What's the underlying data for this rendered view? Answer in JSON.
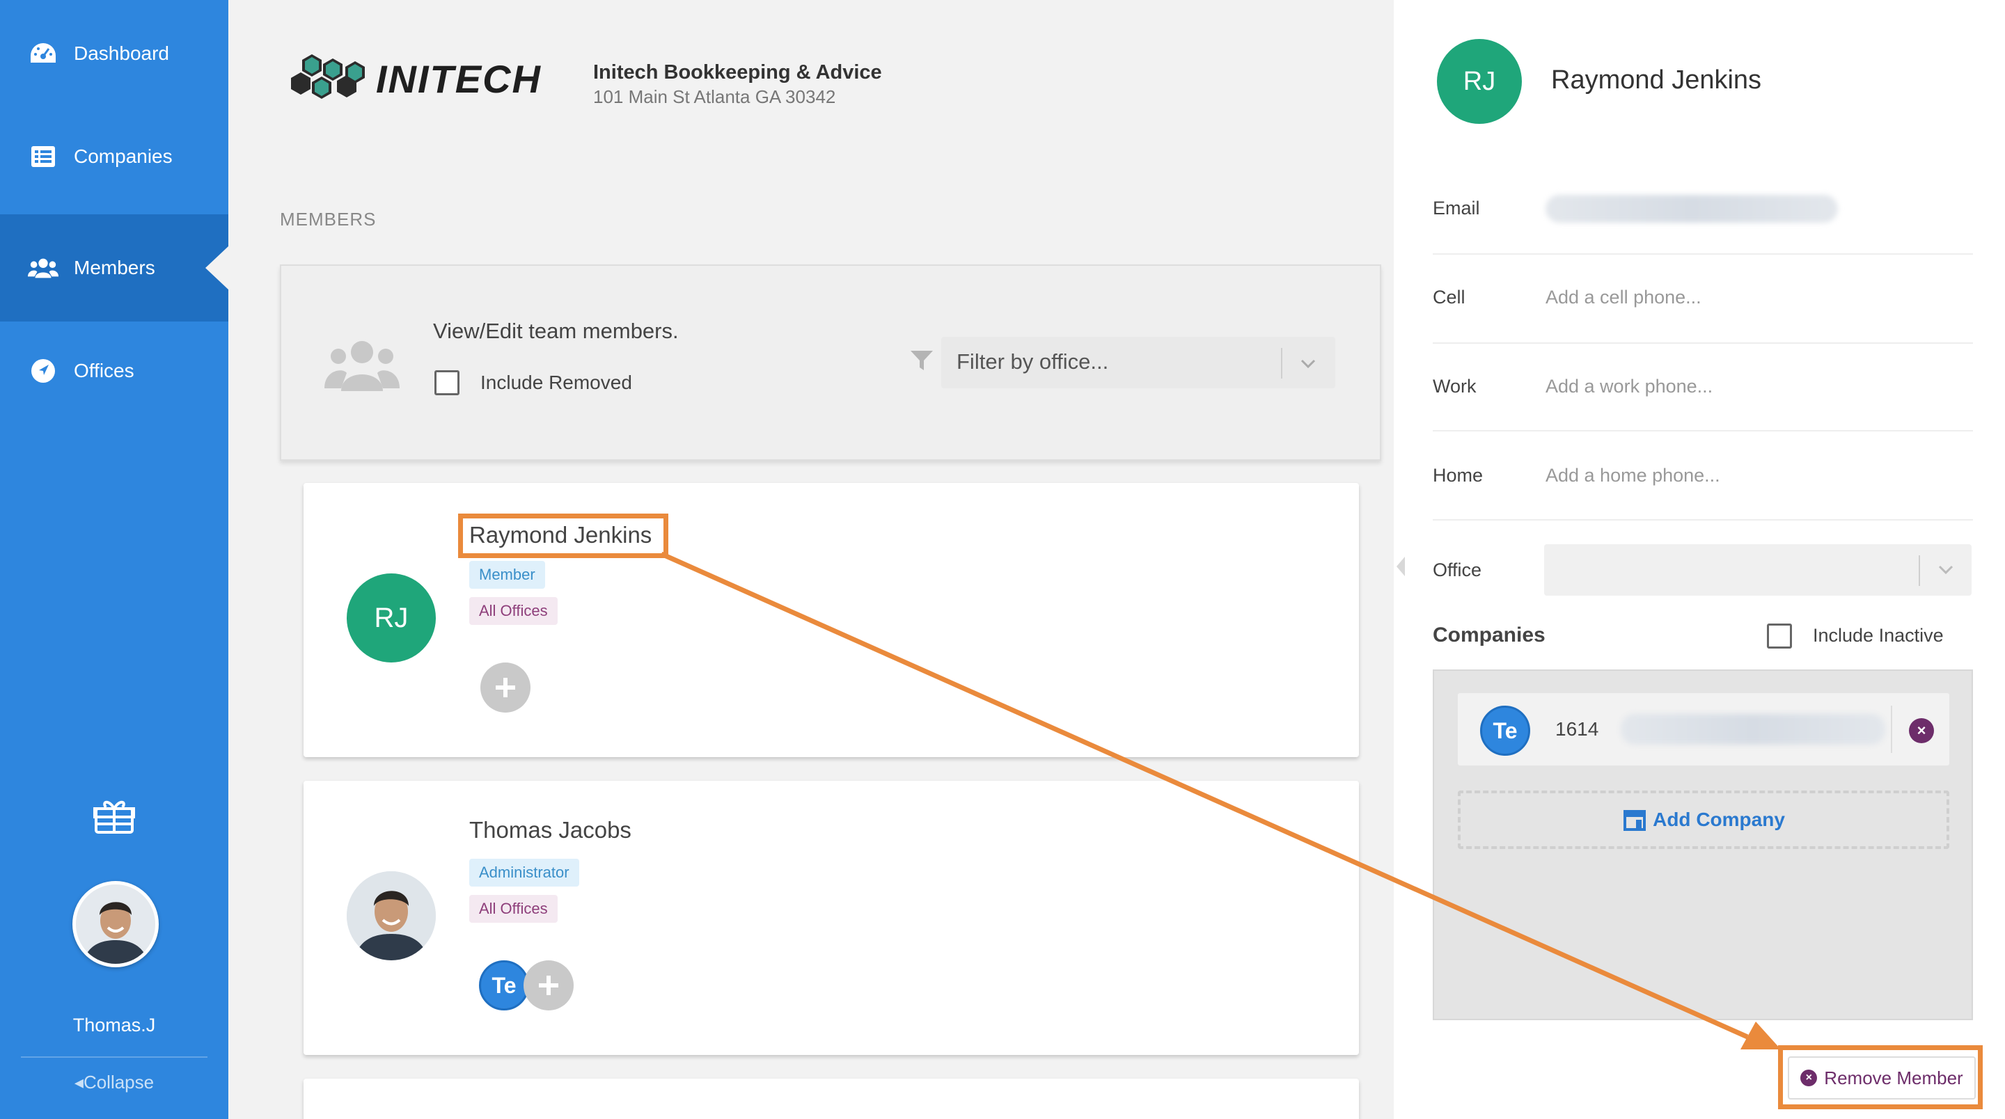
{
  "sidebar": {
    "items": [
      {
        "label": "Dashboard",
        "icon": "dashboard-icon"
      },
      {
        "label": "Companies",
        "icon": "list-icon"
      },
      {
        "label": "Members",
        "icon": "users-icon",
        "active": true
      },
      {
        "label": "Offices",
        "icon": "location-arrow-icon"
      }
    ],
    "user_name": "Thomas.J",
    "collapse_label": "Collapse"
  },
  "header": {
    "logo_text": "INITECH",
    "org_name": "Initech Bookkeeping & Advice",
    "org_address": "101 Main St Atlanta GA 30342"
  },
  "members_section": {
    "label": "MEMBERS",
    "filter_card": {
      "title": "View/Edit team members.",
      "include_removed_label": "Include Removed",
      "include_removed_checked": false,
      "office_filter_placeholder": "Filter by office..."
    },
    "members": [
      {
        "initials": "RJ",
        "name": "Raymond Jenkins",
        "role": "Member",
        "offices": "All Offices",
        "avatar_color": "#1fa67a"
      },
      {
        "name": "Thomas Jacobs",
        "role": "Administrator",
        "offices": "All Offices",
        "company_bubble": "Te"
      }
    ]
  },
  "detail": {
    "initials": "RJ",
    "name": "Raymond Jenkins",
    "fields": {
      "email_label": "Email",
      "cell_label": "Cell",
      "cell_placeholder": "Add a cell phone...",
      "work_label": "Work",
      "work_placeholder": "Add a work phone...",
      "home_label": "Home",
      "home_placeholder": "Add a home phone...",
      "office_label": "Office"
    },
    "companies": {
      "title": "Companies",
      "include_inactive_label": "Include Inactive",
      "include_inactive_checked": false,
      "items": [
        {
          "bubble": "Te",
          "number": "1614"
        }
      ],
      "add_label": "Add Company"
    },
    "remove_label": "Remove Member"
  },
  "colors": {
    "sidebar": "#2e86de",
    "sidebar_active": "#1f6fc1",
    "avatar_green": "#1fa67a",
    "annotation_orange": "#ea8a3c",
    "remove_purple": "#6d2d6a"
  }
}
